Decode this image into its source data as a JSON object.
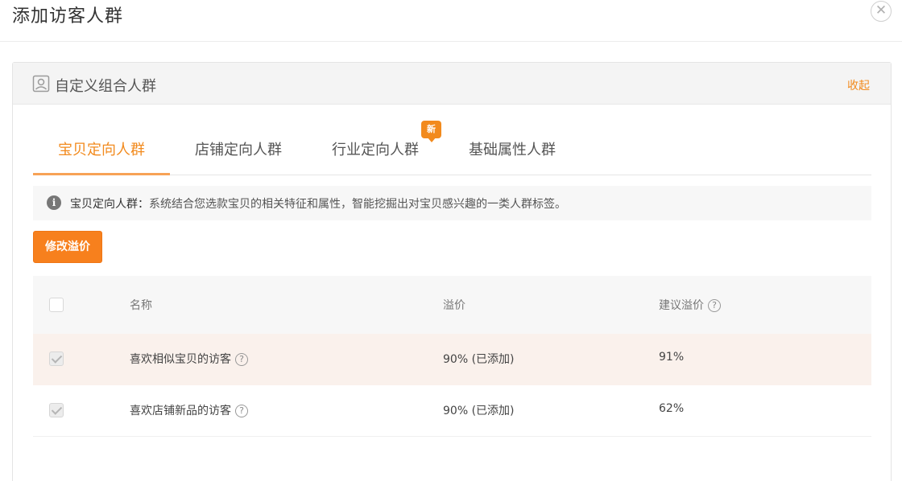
{
  "dialog": {
    "title": "添加访客人群",
    "close_glyph": "✕"
  },
  "panel": {
    "title": "自定义组合人群",
    "collapse_label": "收起"
  },
  "tabs": [
    {
      "label": "宝贝定向人群",
      "active": true
    },
    {
      "label": "店铺定向人群",
      "active": false
    },
    {
      "label": "行业定向人群",
      "active": false,
      "badge": "新"
    },
    {
      "label": "基础属性人群",
      "active": false
    }
  ],
  "notice": {
    "icon": "info-icon",
    "label": "宝贝定向人群：",
    "text": "系统结合您选款宝贝的相关特征和属性，智能挖掘出对宝贝感兴趣的一类人群标签。"
  },
  "actions": {
    "modify_bid_label": "修改溢价"
  },
  "table": {
    "headers": {
      "name": "名称",
      "bid": "溢价",
      "suggested_bid": "建议溢价"
    },
    "rows": [
      {
        "name": "喜欢相似宝贝的访客",
        "bid": "90% (已添加)",
        "suggested_bid": "91%",
        "checked": true
      },
      {
        "name": "喜欢店铺新品的访客",
        "bid": "90% (已添加)",
        "suggested_bid": "62%",
        "checked": true
      }
    ]
  },
  "colors": {
    "accent": "#f28a1d",
    "button": "#f7801d",
    "highlight_row": "#faf1ec"
  }
}
